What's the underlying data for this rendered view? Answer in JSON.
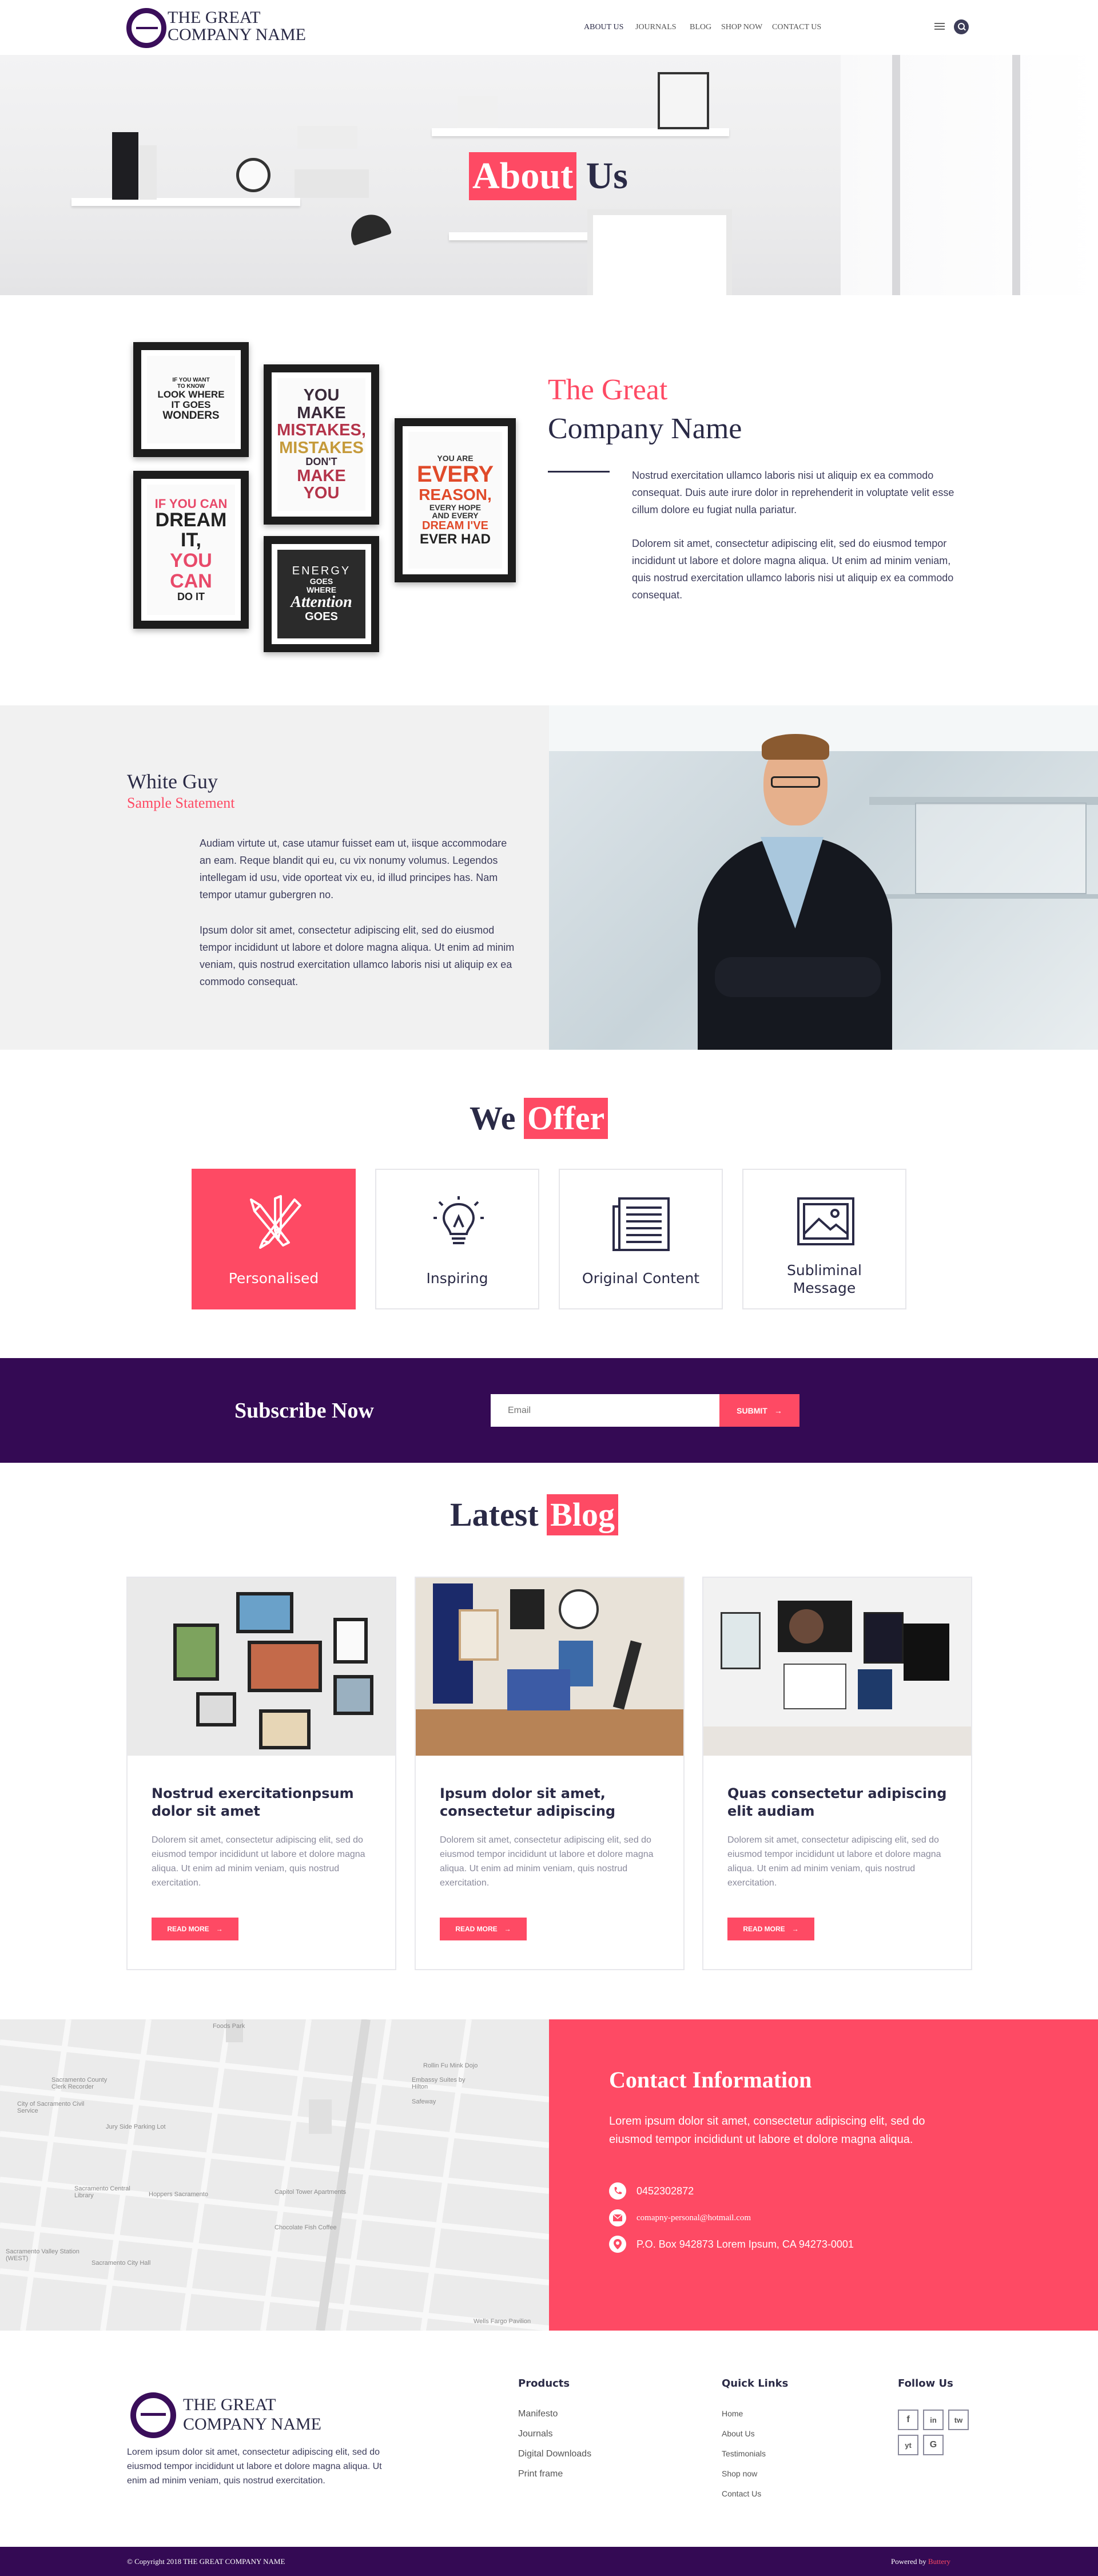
{
  "header": {
    "logo_line1": "THE GREAT",
    "logo_line2": "COMPANY NAME",
    "nav": [
      "ABOUT US",
      "JOURNALS",
      "BLOG",
      "SHOP NOW",
      "CONTACT US"
    ],
    "active_nav": "ABOUT US",
    "menu_icon": "hamburger-icon",
    "search_icon": "search-icon"
  },
  "hero": {
    "title_highlight": "About",
    "title_rest": " Us"
  },
  "about": {
    "posters": [
      {
        "lines": [
          "IF YOU WANT",
          "TO KNOW",
          "LOOK WHERE",
          "IT GOES",
          "WONDERS"
        ]
      },
      {
        "lines": [
          "YOU MAKE",
          "MISTAKES,",
          "MISTAKES",
          "DON'T",
          "MAKE YOU"
        ]
      },
      {
        "lines": [
          "YOU ARE",
          "EVERY",
          "REASON,",
          "EVERY HOPE",
          "AND EVERY",
          "DREAM I'VE",
          "EVER HAD"
        ]
      },
      {
        "lines": [
          "IF YOU CAN",
          "DREAM IT,",
          "YOU CAN",
          "DO IT"
        ]
      },
      {
        "lines": [
          "ENERGY",
          "GOES",
          "WHERE",
          "Attention",
          "GOES"
        ]
      }
    ],
    "heading_line1": "The Great",
    "heading_line2": "Company Name",
    "para1": "Nostrud exercitation ullamco laboris nisi ut aliquip ex ea commodo consequat. Duis aute irure dolor in reprehenderit in voluptate velit esse cillum dolore eu fugiat nulla pariatur.",
    "para2": "Dolorem sit amet, consectetur adipiscing elit, sed do eiusmod tempor incididunt ut labore et dolore magna aliqua. Ut enim ad minim veniam, quis nostrud exercitation ullamco laboris nisi ut aliquip ex ea commodo consequat."
  },
  "person": {
    "name": "White Guy",
    "subtitle": "Sample Statement",
    "para1": "Audiam virtute ut, case utamur fuisset eam ut, iisque accommodare an eam. Reque blandit qui eu, cu vix nonumy volumus. Legendos intellegam id usu, vide oporteat vix eu, id illud principes has. Nam tempor utamur gubergren no.",
    "para2": "Ipsum dolor sit amet, consectetur adipiscing elit, sed do eiusmod tempor incididunt ut labore et dolore magna aliqua. Ut enim ad minim veniam, quis nostrud exercitation ullamco laboris nisi ut aliquip ex ea commodo consequat."
  },
  "offer": {
    "title_rest": "We ",
    "title_highlight": "Offer",
    "items": [
      {
        "label": "Personalised",
        "icon": "pen-brush-icon"
      },
      {
        "label": "Inspiring",
        "icon": "lightbulb-icon"
      },
      {
        "label": "Original Content",
        "icon": "document-icon"
      },
      {
        "label": "Subliminal\nMessage",
        "icon": "image-icon"
      }
    ]
  },
  "subscribe": {
    "title": "Subscribe Now",
    "placeholder": "Email",
    "button": "SUBMIT"
  },
  "blog": {
    "title_rest": "Latest ",
    "title_highlight": "Blog",
    "posts": [
      {
        "title": "Nostrud exercitationpsum dolor sit amet",
        "text": "Dolorem sit amet, consectetur adipiscing elit, sed do eiusmod tempor incididunt ut labore et dolore magna aliqua. Ut enim ad minim veniam, quis nostrud exercitation.",
        "button": "READ MORE"
      },
      {
        "title": "Ipsum dolor sit amet, consectetur adipiscing",
        "text": "Dolorem sit amet, consectetur adipiscing elit, sed do eiusmod tempor incididunt ut labore et dolore magna aliqua. Ut enim ad minim veniam, quis nostrud exercitation.",
        "button": "READ MORE"
      },
      {
        "title": "Quas consectetur adipiscing elit audiam",
        "text": "Dolorem sit amet, consectetur adipiscing elit, sed do eiusmod tempor incididunt ut labore et dolore magna aliqua. Ut enim ad minim veniam, quis nostrud exercitation.",
        "button": "READ MORE"
      }
    ]
  },
  "contact": {
    "title": "Contact Information",
    "text": "Lorem ipsum dolor sit amet, consectetur adipiscing elit, sed do eiusmod tempor incididunt ut labore et dolore magna aliqua.",
    "phone": "0452302872",
    "email": "comapny-personal@hotmail.com",
    "address": "P.O. Box 942873 Lorem Ipsum, CA 94273-0001"
  },
  "map_labels": [
    "Sacramento County Clerk Recorder",
    "City of Sacramento Civil Service",
    "Rollin Fu Mink Dojo",
    "Jury Side Parking Lot",
    "Sacramento Central Library",
    "Hoppers Sacramento",
    "Capitol Tower Apartments",
    "Chocolate Fish Coffee",
    "Wells Fargo Pavilion",
    "Sacramento City Hall",
    "Sacramento Valley Station (WEST)",
    "Foods Park",
    "Safeway",
    "Embassy Suites by Hilton"
  ],
  "footer": {
    "logo_line1": "THE GREAT",
    "logo_line2": "COMPANY NAME",
    "about": "Lorem ipsum dolor sit amet, consectetur adipiscing elit, sed do eiusmod tempor incididunt ut labore et dolore magna aliqua. Ut enim ad minim veniam, quis nostrud exercitation.",
    "products_title": "Products",
    "products": [
      "Manifesto",
      "Journals",
      "Digital Downloads",
      "Print frame"
    ],
    "quick_title": "Quick Links",
    "quick": [
      "Home",
      "About Us",
      "Testimonials",
      "Shop now",
      "Contact Us"
    ],
    "follow_title": "Follow Us",
    "social": [
      "f",
      "in",
      "tw",
      "yt",
      "G"
    ],
    "copyright": "© Copyright 2018 THE GREAT COMPANY NAME",
    "powered_label": "Powered by",
    "powered_name": "Buttery"
  },
  "colors": {
    "accent": "#fe4a64",
    "brand": "#340a54",
    "text": "#2a2a46"
  }
}
